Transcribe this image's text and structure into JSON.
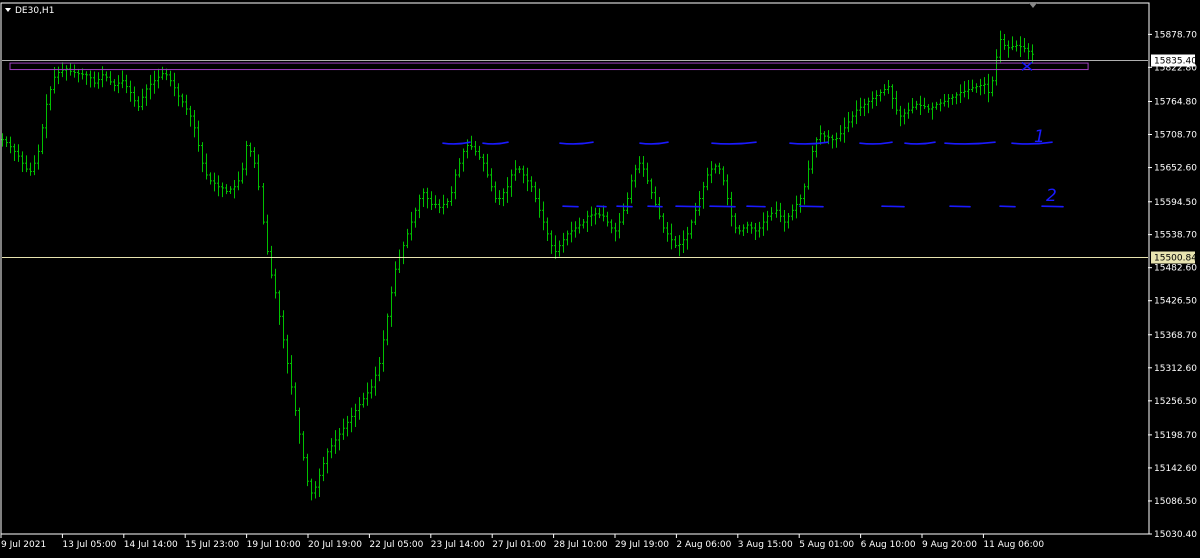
{
  "chart_data": {
    "type": "bar",
    "subtype": "ohlc",
    "symbol_label": "DE30,H1",
    "colors": {
      "background": "#000000",
      "frame": "#ffffff",
      "bars": "#00c000",
      "text": "#ffffff",
      "current_price_line": "#b0b0b0",
      "level_line": "#e8e4b0",
      "level_label_bg": "#e8e4b0",
      "current_label_bg": "#ffffff",
      "zone": "#a040c0",
      "annotation": "#1a1aff"
    },
    "ylim": [
      15030.4,
      15932
    ],
    "y_ticks": [
      "15878.70",
      "15822.80",
      "15764.80",
      "15708.70",
      "15652.60",
      "15594.50",
      "15538.70",
      "15482.60",
      "15426.50",
      "15368.70",
      "15312.60",
      "15256.50",
      "15198.70",
      "15142.60",
      "15086.50",
      "15030.40"
    ],
    "x_ticks": [
      "9 Jul 2021",
      "13 Jul 05:00",
      "14 Jul 14:00",
      "15 Jul 23:00",
      "19 Jul 10:00",
      "20 Jul 19:00",
      "22 Jul 05:00",
      "23 Jul 14:00",
      "27 Jul 01:00",
      "28 Jul 10:00",
      "29 Jul 19:00",
      "2 Aug 06:00",
      "3 Aug 15:00",
      "5 Aug 01:00",
      "6 Aug 10:00",
      "9 Aug 20:00",
      "11 Aug 06:00"
    ],
    "current_price": "15835.40",
    "horizontal_level": "15500.84",
    "zone": {
      "top": 15830,
      "bottom": 15819,
      "start_index": 1,
      "end_index": 269
    },
    "annotations": [
      {
        "label": "1",
        "level": 15694
      },
      {
        "label": "2",
        "level": 15587
      }
    ],
    "closes": [
      15700,
      15695,
      15688,
      15680,
      15672,
      15660,
      15650,
      15646,
      15660,
      15680,
      15720,
      15760,
      15785,
      15806,
      15814,
      15818,
      15820,
      15816,
      15814,
      15812,
      15811,
      15810,
      15805,
      15796,
      15802,
      15810,
      15806,
      15798,
      15792,
      15796,
      15800,
      15790,
      15780,
      15766,
      15756,
      15772,
      15786,
      15794,
      15800,
      15806,
      15812,
      15810,
      15800,
      15788,
      15774,
      15764,
      15752,
      15740,
      15720,
      15690,
      15660,
      15640,
      15630,
      15626,
      15620,
      15618,
      15612,
      15616,
      15620,
      15630,
      15650,
      15690,
      15680,
      15660,
      15620,
      15560,
      15510,
      15470,
      15440,
      15400,
      15360,
      15320,
      15280,
      15240,
      15200,
      15160,
      15120,
      15100,
      15110,
      15130,
      15150,
      15170,
      15180,
      15190,
      15200,
      15210,
      15220,
      15230,
      15240,
      15250,
      15260,
      15270,
      15280,
      15300,
      15320,
      15360,
      15400,
      15440,
      15480,
      15500,
      15520,
      15540,
      15560,
      15580,
      15600,
      15610,
      15600,
      15590,
      15590,
      15585,
      15590,
      15595,
      15610,
      15640,
      15660,
      15680,
      15690,
      15688,
      15680,
      15670,
      15660,
      15640,
      15620,
      15600,
      15600,
      15610,
      15620,
      15640,
      15650,
      15650,
      15640,
      15630,
      15620,
      15600,
      15580,
      15560,
      15540,
      15520,
      15510,
      15520,
      15530,
      15540,
      15545,
      15550,
      15555,
      15560,
      15570,
      15572,
      15574,
      15572,
      15570,
      15560,
      15550,
      15545,
      15560,
      15580,
      15600,
      15630,
      15650,
      15660,
      15650,
      15630,
      15610,
      15590,
      15570,
      15550,
      15540,
      15530,
      15520,
      15522,
      15530,
      15540,
      15560,
      15580,
      15600,
      15620,
      15640,
      15650,
      15655,
      15650,
      15630,
      15600,
      15570,
      15550,
      15545,
      15550,
      15555,
      15550,
      15545,
      15550,
      15560,
      15570,
      15575,
      15580,
      15570,
      15560,
      15570,
      15580,
      15590,
      15600,
      15620,
      15650,
      15680,
      15700,
      15710,
      15706,
      15704,
      15700,
      15702,
      15710,
      15720,
      15730,
      15740,
      15750,
      15755,
      15760,
      15765,
      15770,
      15775,
      15780,
      15785,
      15790,
      15770,
      15750,
      15740,
      15745,
      15750,
      15755,
      15760,
      15758,
      15756,
      15752,
      15755,
      15760,
      15762,
      15765,
      15770,
      15772,
      15776,
      15780,
      15782,
      15785,
      15788,
      15790,
      15792,
      15794,
      15780,
      15800,
      15840,
      15870,
      15860,
      15856,
      15858,
      15860,
      15858,
      15855,
      15850,
      15845
    ]
  }
}
